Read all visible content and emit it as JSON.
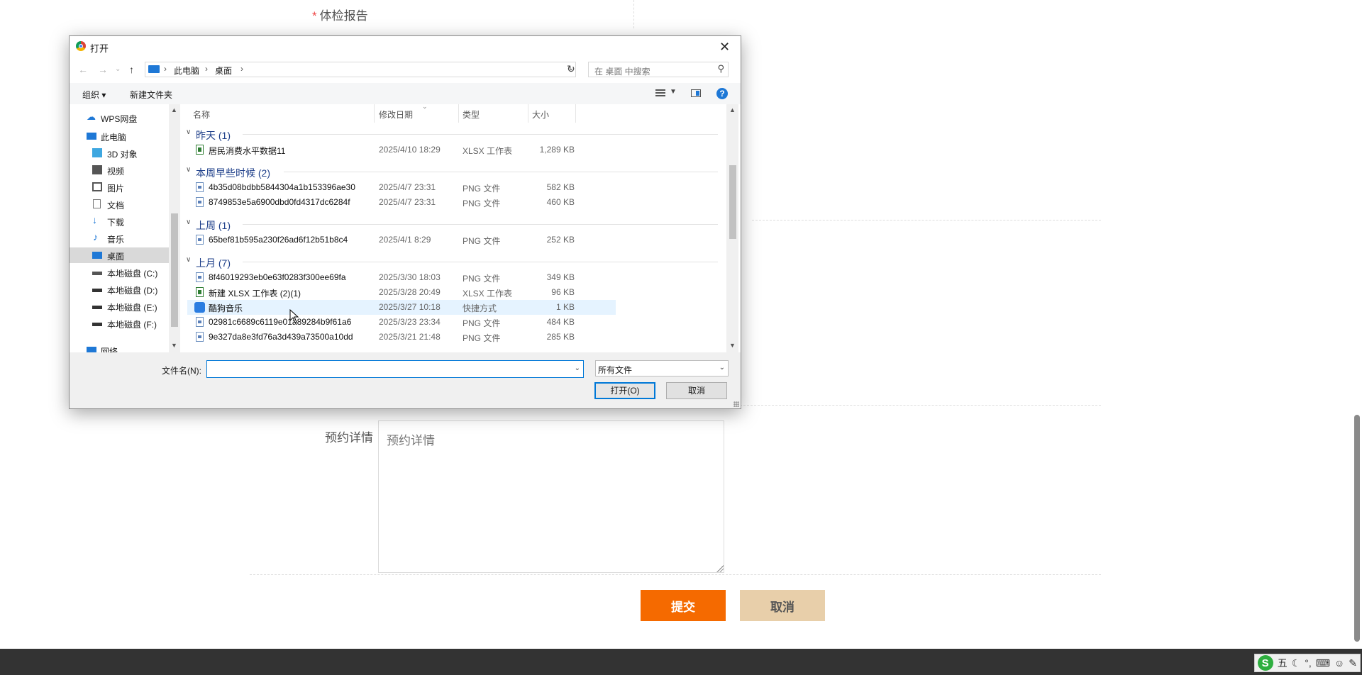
{
  "page": {
    "required_field_label": "体检报告",
    "required_mark": "*",
    "detail_label": "预约详情",
    "detail_placeholder": "预约详情",
    "submit_button": "提交",
    "cancel_button": "取消"
  },
  "ime": {
    "logo": "S",
    "mode": "五",
    "icons": [
      "moon-icon",
      "punctuation-icon",
      "keyboard-icon",
      "user-icon",
      "wrench-icon"
    ]
  },
  "dialog": {
    "title": "打开",
    "close": "✕",
    "nav": {
      "back": "←",
      "forward": "→",
      "recent": "⌄",
      "up": "↑"
    },
    "address": {
      "crumbs": [
        "此电脑",
        "桌面"
      ],
      "separator": "›"
    },
    "search_placeholder": "在 桌面 中搜索",
    "toolbar": {
      "organize": "组织 ▾",
      "new_folder": "新建文件夹",
      "help": "?"
    },
    "nav_pane": [
      {
        "label": "WPS网盘",
        "icon": "cloud-icon"
      },
      {
        "label": "此电脑",
        "icon": "computer-icon"
      },
      {
        "label": "3D 对象",
        "icon": "3d-objects-icon"
      },
      {
        "label": "视频",
        "icon": "video-icon"
      },
      {
        "label": "图片",
        "icon": "pictures-icon"
      },
      {
        "label": "文档",
        "icon": "documents-icon"
      },
      {
        "label": "下载",
        "icon": "download-icon"
      },
      {
        "label": "音乐",
        "icon": "music-icon"
      },
      {
        "label": "桌面",
        "icon": "desktop-icon",
        "selected": true
      },
      {
        "label": "本地磁盘 (C:)",
        "icon": "drive-icon"
      },
      {
        "label": "本地磁盘 (D:)",
        "icon": "drive-icon"
      },
      {
        "label": "本地磁盘 (E:)",
        "icon": "drive-icon"
      },
      {
        "label": "本地磁盘 (F:)",
        "icon": "drive-icon"
      },
      {
        "label": "网络",
        "icon": "network-icon"
      }
    ],
    "columns": [
      "名称",
      "修改日期",
      "类型",
      "大小"
    ],
    "groups": [
      {
        "title": "昨天 (1)",
        "files": [
          {
            "name": "居民消费水平数据11",
            "date": "2025/4/10 18:29",
            "type": "XLSX 工作表",
            "size": "1,289 KB",
            "kind": "xlsx"
          }
        ]
      },
      {
        "title": "本周早些时候 (2)",
        "files": [
          {
            "name": "4b35d08bdbb5844304a1b153396ae30",
            "date": "2025/4/7 23:31",
            "type": "PNG 文件",
            "size": "582 KB",
            "kind": "png"
          },
          {
            "name": "8749853e5a6900dbd0fd4317dc6284f",
            "date": "2025/4/7 23:31",
            "type": "PNG 文件",
            "size": "460 KB",
            "kind": "png"
          }
        ]
      },
      {
        "title": "上周 (1)",
        "files": [
          {
            "name": "65bef81b595a230f26ad6f12b51b8c4",
            "date": "2025/4/1 8:29",
            "type": "PNG 文件",
            "size": "252 KB",
            "kind": "png"
          }
        ]
      },
      {
        "title": "上月 (7)",
        "files": [
          {
            "name": "8f46019293eb0e63f0283f300ee69fa",
            "date": "2025/3/30 18:03",
            "type": "PNG 文件",
            "size": "349 KB",
            "kind": "png"
          },
          {
            "name": "新建 XLSX 工作表 (2)(1)",
            "date": "2025/3/28 20:49",
            "type": "XLSX 工作表",
            "size": "96 KB",
            "kind": "xlsx"
          },
          {
            "name": "酷狗音乐",
            "date": "2025/3/27 10:18",
            "type": "快捷方式",
            "size": "1 KB",
            "kind": "lnk",
            "hover": true
          },
          {
            "name": "02981c6689c6119e01a89284b9f61a6",
            "date": "2025/3/23 23:34",
            "type": "PNG 文件",
            "size": "484 KB",
            "kind": "png"
          },
          {
            "name": "9e327da8e3fd76a3d439a73500a10dd",
            "date": "2025/3/21 21:48",
            "type": "PNG 文件",
            "size": "285 KB",
            "kind": "png"
          }
        ]
      }
    ],
    "filename_label": "文件名(N):",
    "filename_value": "",
    "filetype_value": "所有文件",
    "open_button": "打开(O)",
    "cancel_button": "取消"
  }
}
